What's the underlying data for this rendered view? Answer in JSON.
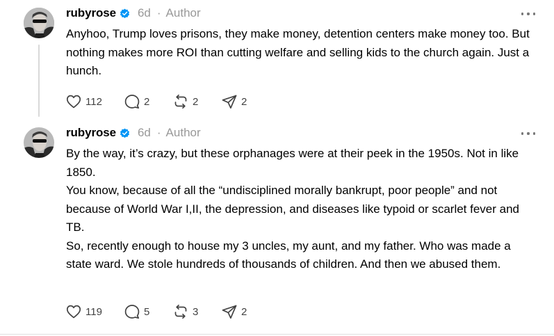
{
  "posts": [
    {
      "username": "rubyrose",
      "time": "6d",
      "dot": "·",
      "author_label": "Author",
      "paragraphs": [
        "Anyhoo, Trump loves prisons, they make money, detention centers make money too. But nothing makes more ROI than cutting welfare and selling kids to the church again. Just a hunch."
      ],
      "likes": "112",
      "replies": "2",
      "reposts": "2",
      "shares": "2"
    },
    {
      "username": "rubyrose",
      "time": "6d",
      "dot": "·",
      "author_label": "Author",
      "paragraphs": [
        "By the way, it’s crazy, but these orphanages were at their peek in the 1950s. Not in like 1850.",
        "You know, because of all the “undisciplined morally bankrupt, poor people” and not because of World War I,II, the depression, and diseases like typoid or scarlet fever and TB.",
        "So, recently enough to house my 3 uncles, my aunt, and my father. Who was made a state ward. We stole hundreds of thousands of children. And then we abused them."
      ],
      "likes": "119",
      "replies": "5",
      "reposts": "3",
      "shares": "2"
    }
  ],
  "colors": {
    "text": "#000000",
    "meta": "#999999",
    "verified": "#0095f6",
    "thread_line": "#d9d9d9",
    "icon": "#424242"
  }
}
